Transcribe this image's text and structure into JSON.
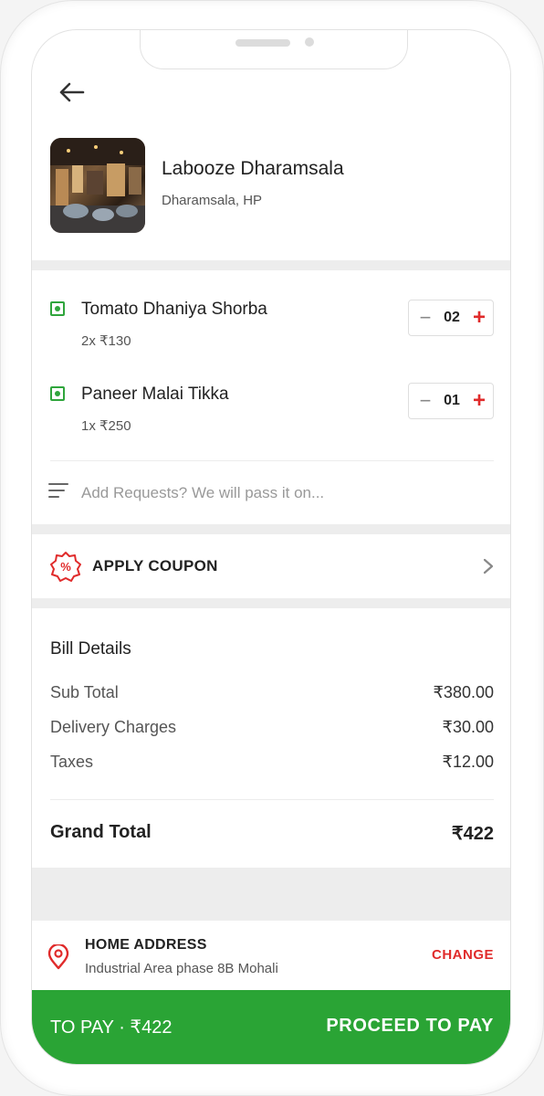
{
  "restaurant": {
    "name": "Labooze Dharamsala",
    "location": "Dharamsala, HP"
  },
  "items": [
    {
      "name": "Tomato Dhaniya Shorba",
      "qty_price": "2x ₹130",
      "count": "02",
      "veg": true
    },
    {
      "name": "Paneer Malai Tikka",
      "qty_price": "1x ₹250",
      "count": "01",
      "veg": true
    }
  ],
  "requests": {
    "placeholder": "Add Requests? We will pass it on..."
  },
  "coupon": {
    "label": "APPLY COUPON"
  },
  "bill": {
    "title": "Bill Details",
    "rows": [
      {
        "label": "Sub Total",
        "value": "₹380.00"
      },
      {
        "label": "Delivery Charges",
        "value": "₹30.00"
      },
      {
        "label": "Taxes",
        "value": "₹12.00"
      }
    ],
    "grand_label": "Grand Total",
    "grand_value": "₹422"
  },
  "address": {
    "title": "HOME ADDRESS",
    "line": "Industrial Area phase 8B Mohali",
    "change_label": "CHANGE"
  },
  "pay": {
    "to_pay": "TO PAY · ₹422",
    "proceed": "PROCEED TO PAY"
  },
  "colors": {
    "green": "#2aa435",
    "red": "#e02b2b",
    "veg_green": "#2fa53c"
  }
}
